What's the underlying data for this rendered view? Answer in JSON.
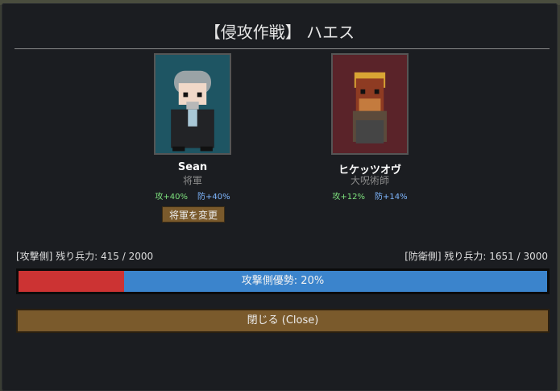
{
  "title": "【侵攻作戦】 ハエス",
  "attacker": {
    "name": "Sean",
    "role": "将軍",
    "atk_label": "攻",
    "atk_value": "+40%",
    "def_label": "防",
    "def_value": "+40%",
    "change_button": "将軍を変更",
    "portrait_icon": "general-portrait-icon"
  },
  "defender": {
    "name": "ヒケッツオヴ",
    "role": "大呪術師",
    "atk_label": "攻",
    "atk_value": "+12%",
    "def_label": "防",
    "def_value": "+14%",
    "portrait_icon": "sorcerer-portrait-icon"
  },
  "attacker_troops": "[攻撃側] 残り兵力: 415 / 2000",
  "defender_troops": "[防衛側] 残り兵力: 1651 / 3000",
  "advantage": {
    "text": "攻撃側優勢: 20%",
    "attacker_share": 0.2,
    "attacker_color": "#cc3333",
    "defender_color": "#3b84cc"
  },
  "close_button": "閉じる (Close)"
}
